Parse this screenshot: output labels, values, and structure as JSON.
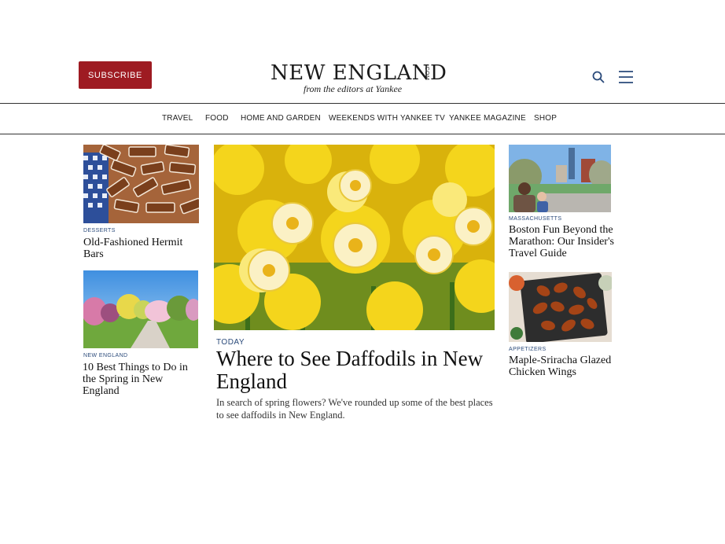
{
  "header": {
    "subscribe_label": "SUBSCRIBE",
    "logo_text": "NEW ENGLAND",
    "logo_com": ".COM",
    "logo_tagline": "from the editors at Yankee",
    "search_icon": "search-icon",
    "menu_icon": "hamburger-menu-icon",
    "accent_color": "#9e1b22"
  },
  "nav": {
    "items": [
      {
        "label": "TRAVEL"
      },
      {
        "label": "FOOD"
      },
      {
        "label": "HOME AND GARDEN"
      },
      {
        "label": "WEEKENDS WITH YANKEE TV"
      },
      {
        "label": "YANKEE MAGAZINE"
      },
      {
        "label": "SHOP"
      }
    ]
  },
  "left_column": [
    {
      "kicker": "DESSERTS",
      "title": "Old-Fashioned Hermit Bars"
    },
    {
      "kicker": "NEW ENGLAND",
      "title": "10 Best Things to Do in the Spring in New England"
    }
  ],
  "feature": {
    "kicker": "TODAY",
    "title": "Where to See Daffodils in New England",
    "dek": "In search of spring flowers? We've rounded up some of the best places to see daffodils in New England."
  },
  "right_column": [
    {
      "kicker": "MASSACHUSETTS",
      "title": "Boston Fun Beyond the Marathon: Our Insider's Travel Guide"
    },
    {
      "kicker": "APPETIZERS",
      "title": "Maple-Sriracha Glazed Chicken Wings"
    }
  ],
  "colors": {
    "kicker": "#2a4a7a",
    "text": "#111111"
  }
}
